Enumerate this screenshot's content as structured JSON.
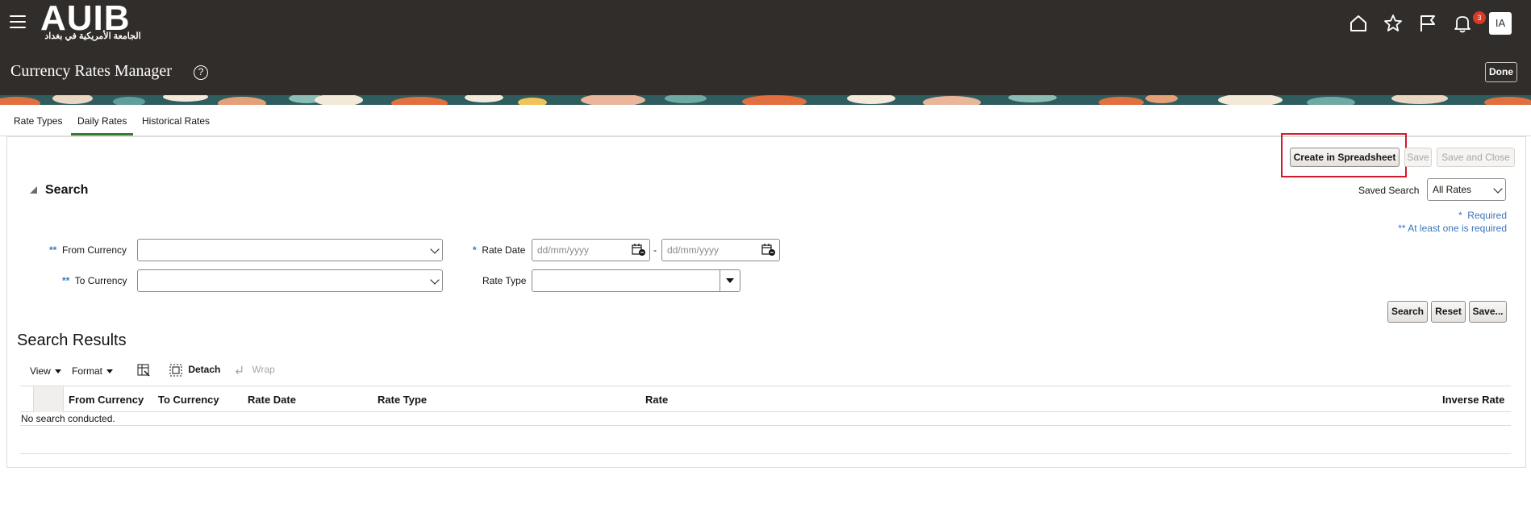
{
  "header": {
    "logo_text": "AUIB",
    "logo_subtext": "الجامعة الأمريكية في بغداد",
    "page_title": "Currency Rates Manager",
    "help_symbol": "?",
    "notification_count": "3",
    "avatar_initials": "IA",
    "done_label": "Done",
    "icons": [
      "home-icon",
      "favorites-star-icon",
      "watchlist-flag-icon",
      "notifications-bell-icon"
    ]
  },
  "tabs": [
    {
      "label": "Rate Types",
      "active": false
    },
    {
      "label": "Daily Rates",
      "active": true
    },
    {
      "label": "Historical Rates",
      "active": false
    }
  ],
  "actions": {
    "create_spreadsheet": "Create in Spreadsheet",
    "save": "Save",
    "save_and_close": "Save and Close"
  },
  "search": {
    "title": "Search",
    "saved_search_label": "Saved Search",
    "saved_search_value": "All Rates",
    "required_marker": "*",
    "required_text": "Required",
    "at_least_one_marker": "**",
    "at_least_one_text": "At least one is required",
    "from_currency_label": "From Currency",
    "to_currency_label": "To Currency",
    "rate_date_label": "Rate Date",
    "rate_type_label": "Rate Type",
    "date_placeholder": "dd/mm/yyyy",
    "date_separator": "-",
    "buttons": {
      "search": "Search",
      "reset": "Reset",
      "save": "Save..."
    }
  },
  "results": {
    "title": "Search Results",
    "toolbar": {
      "view": "View",
      "format": "Format",
      "detach": "Detach",
      "wrap": "Wrap"
    },
    "columns": [
      "From Currency",
      "To Currency",
      "Rate Date",
      "Rate Type",
      "Rate",
      "Inverse Rate"
    ],
    "empty_message": "No search conducted."
  },
  "colors": {
    "header_bg": "#312d2a",
    "accent_tab": "#2e7d32",
    "required_blue": "#3b76ba",
    "highlight_red": "#d6192b",
    "badge_red": "#d63b25"
  }
}
